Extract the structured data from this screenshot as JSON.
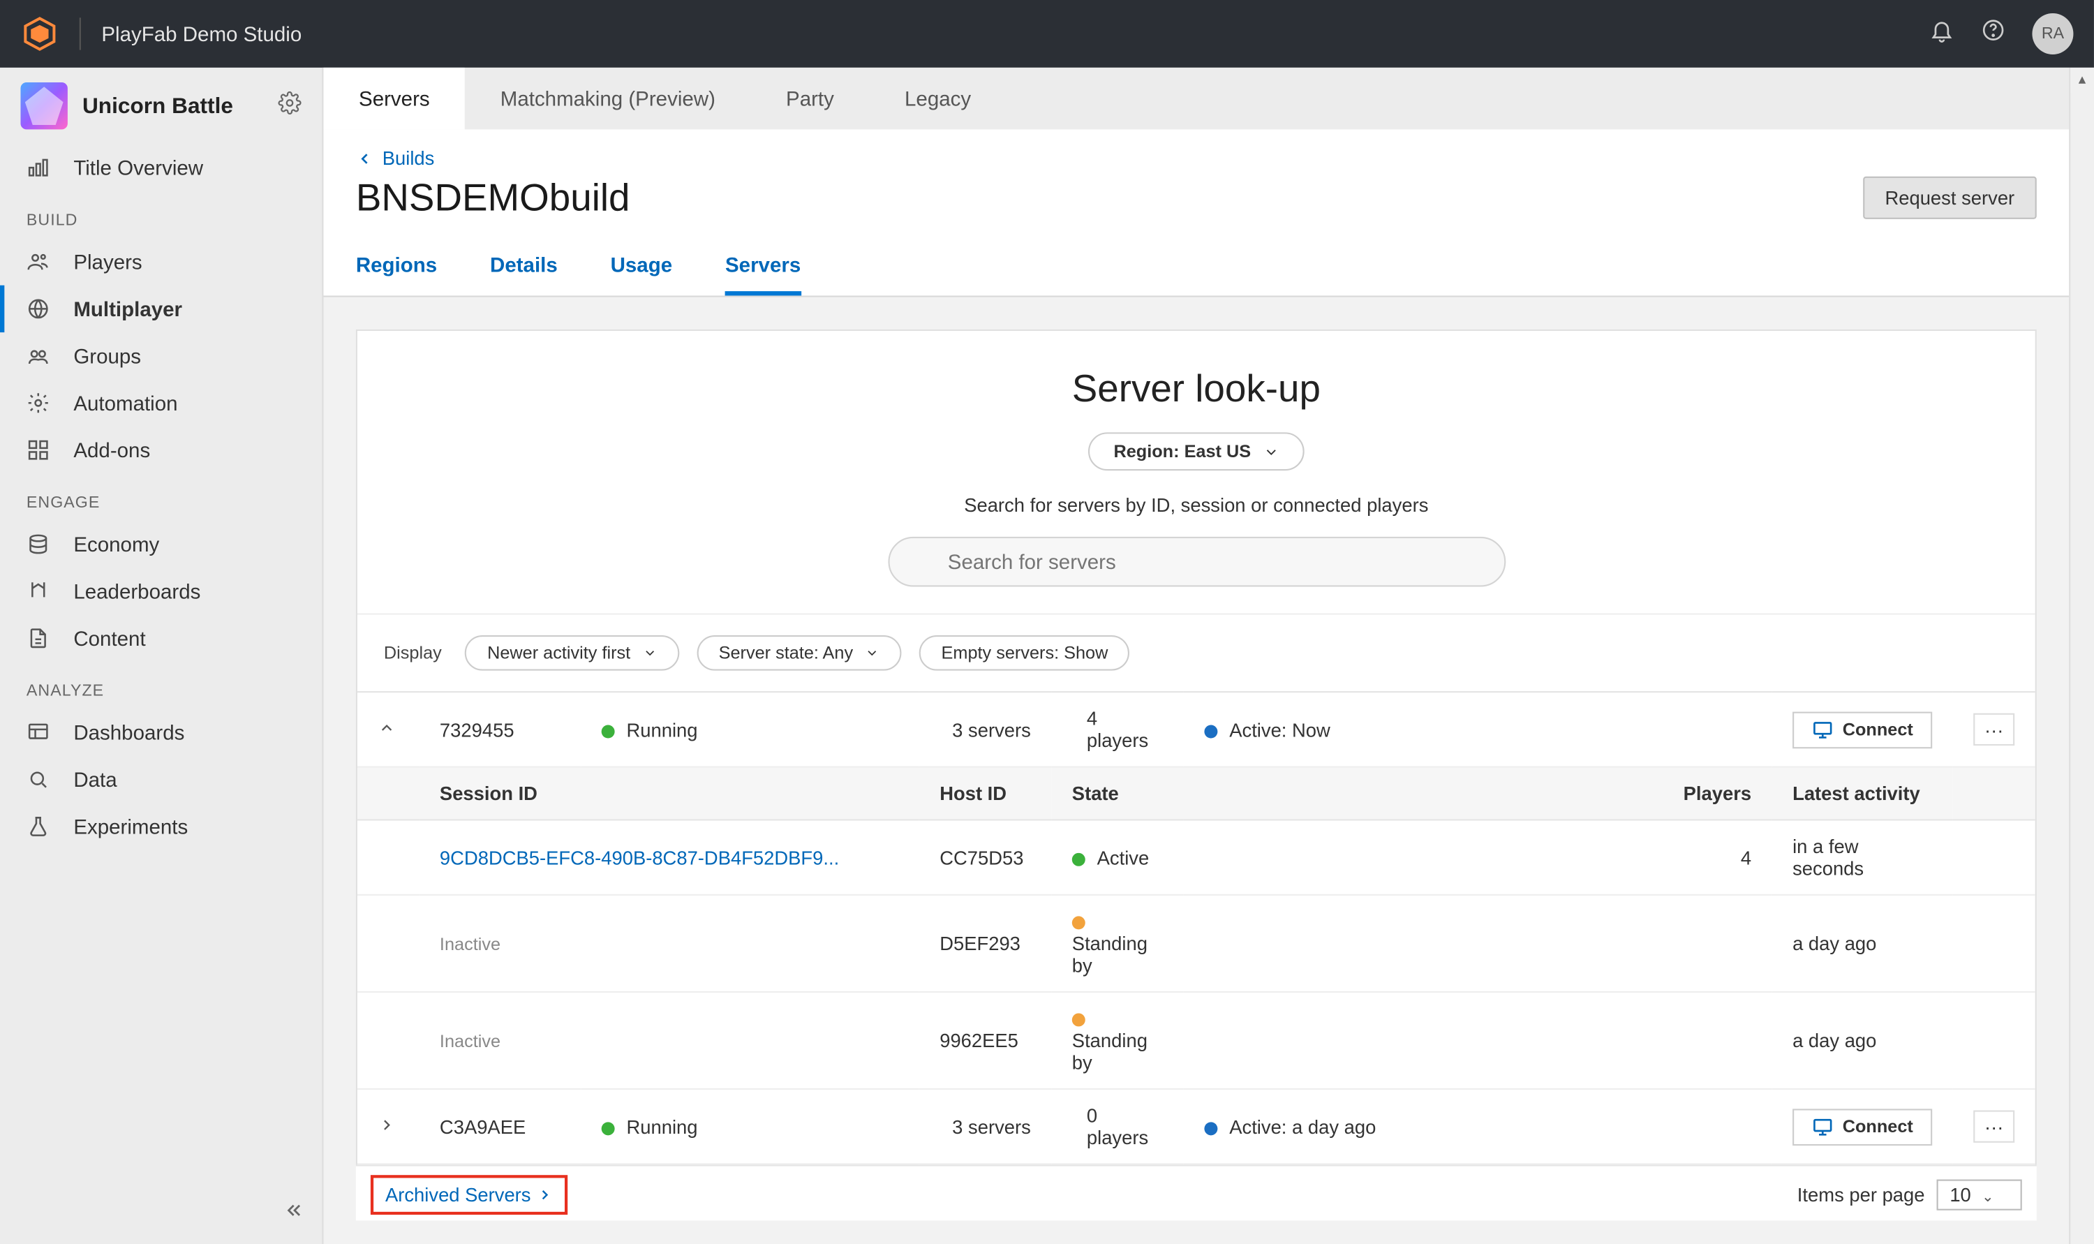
{
  "topbar": {
    "studio": "PlayFab Demo Studio",
    "avatar_initials": "RA"
  },
  "sidebar": {
    "title_name": "Unicorn Battle",
    "overview": "Title Overview",
    "sections": {
      "build": {
        "label": "BUILD",
        "items": [
          "Players",
          "Multiplayer",
          "Groups",
          "Automation",
          "Add-ons"
        ]
      },
      "engage": {
        "label": "ENGAGE",
        "items": [
          "Economy",
          "Leaderboards",
          "Content"
        ]
      },
      "analyze": {
        "label": "ANALYZE",
        "items": [
          "Dashboards",
          "Data",
          "Experiments"
        ]
      }
    }
  },
  "tabs": {
    "top": [
      "Servers",
      "Matchmaking (Preview)",
      "Party",
      "Legacy"
    ],
    "active_top": 0
  },
  "page": {
    "breadcrumb": "Builds",
    "title": "BNSDEMObuild",
    "request_btn": "Request server",
    "subtabs": [
      "Regions",
      "Details",
      "Usage",
      "Servers"
    ],
    "active_subtab": 3
  },
  "lookup": {
    "title": "Server look-up",
    "region_label": "Region: East US",
    "subtitle": "Search for servers by ID, session or connected players",
    "search_placeholder": "Search for servers"
  },
  "filters": {
    "display_label": "Display",
    "sort": "Newer activity first",
    "state": "Server state: Any",
    "empty": "Empty servers: Show"
  },
  "columns": [
    "Session ID",
    "Host ID",
    "State",
    "Players",
    "Latest activity"
  ],
  "groups": [
    {
      "id": "7329455",
      "status": "Running",
      "servers": "3 servers",
      "players": "4 players",
      "active": "Active: Now",
      "connect": "Connect",
      "expanded": true,
      "rows": [
        {
          "session": "9CD8DCB5-EFC8-490B-8C87-DB4F52DBF9...",
          "session_link": true,
          "host": "CC75D53",
          "state": "Active",
          "state_color": "green",
          "players": "4",
          "activity": "in a few seconds"
        },
        {
          "session": "Inactive",
          "session_link": false,
          "host": "D5EF293",
          "state": "Standing by",
          "state_color": "orange",
          "players": "",
          "activity": "a day ago"
        },
        {
          "session": "Inactive",
          "session_link": false,
          "host": "9962EE5",
          "state": "Standing by",
          "state_color": "orange",
          "players": "",
          "activity": "a day ago"
        }
      ]
    },
    {
      "id": "C3A9AEE",
      "status": "Running",
      "servers": "3 servers",
      "players": "0 players",
      "active": "Active: a day ago",
      "connect": "Connect",
      "expanded": false,
      "rows": []
    }
  ],
  "footer": {
    "archived": "Archived Servers",
    "items_label": "Items per page",
    "items_value": "10"
  }
}
